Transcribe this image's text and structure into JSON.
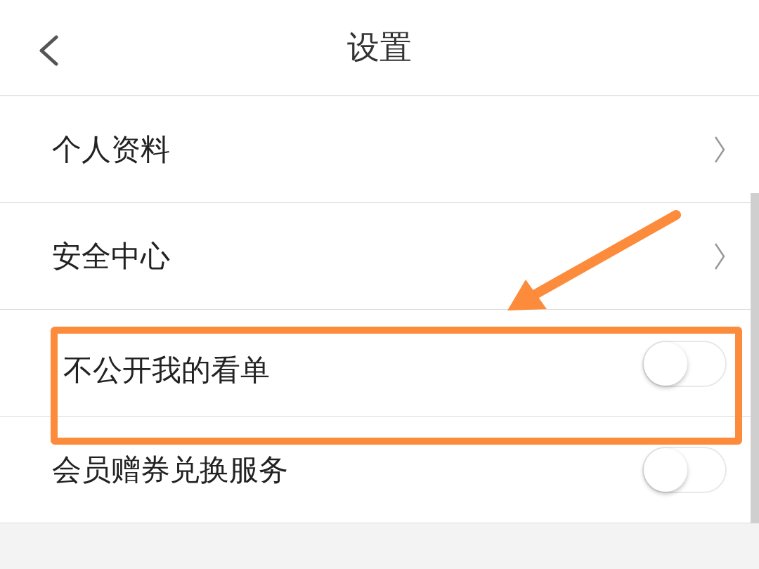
{
  "header": {
    "title": "设置"
  },
  "rows": [
    {
      "kind": "link",
      "label": "个人资料",
      "highlighted": false
    },
    {
      "kind": "link",
      "label": "安全中心",
      "highlighted": false
    },
    {
      "kind": "toggle",
      "label": "不公开我的看单",
      "on": false,
      "highlighted": true
    },
    {
      "kind": "toggle",
      "label": "会员赠券兑换服务",
      "on": false,
      "highlighted": false
    }
  ]
}
